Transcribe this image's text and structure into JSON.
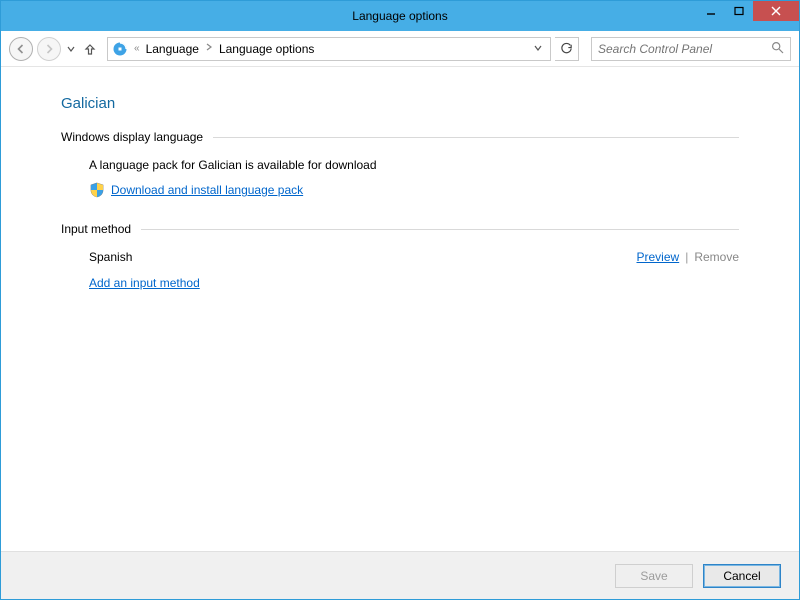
{
  "window": {
    "title": "Language options"
  },
  "nav": {
    "breadcrumb": {
      "part1": "Language",
      "part2": "Language options"
    },
    "search_placeholder": "Search Control Panel"
  },
  "page": {
    "language_name": "Galician",
    "sections": {
      "display": {
        "header": "Windows display language",
        "info": "A language pack for Galician is available for download",
        "download_link": "Download and install language pack"
      },
      "input": {
        "header": "Input method",
        "method_name": "Spanish",
        "preview": "Preview",
        "remove": "Remove",
        "add_link": "Add an input method"
      }
    }
  },
  "footer": {
    "save": "Save",
    "cancel": "Cancel"
  }
}
